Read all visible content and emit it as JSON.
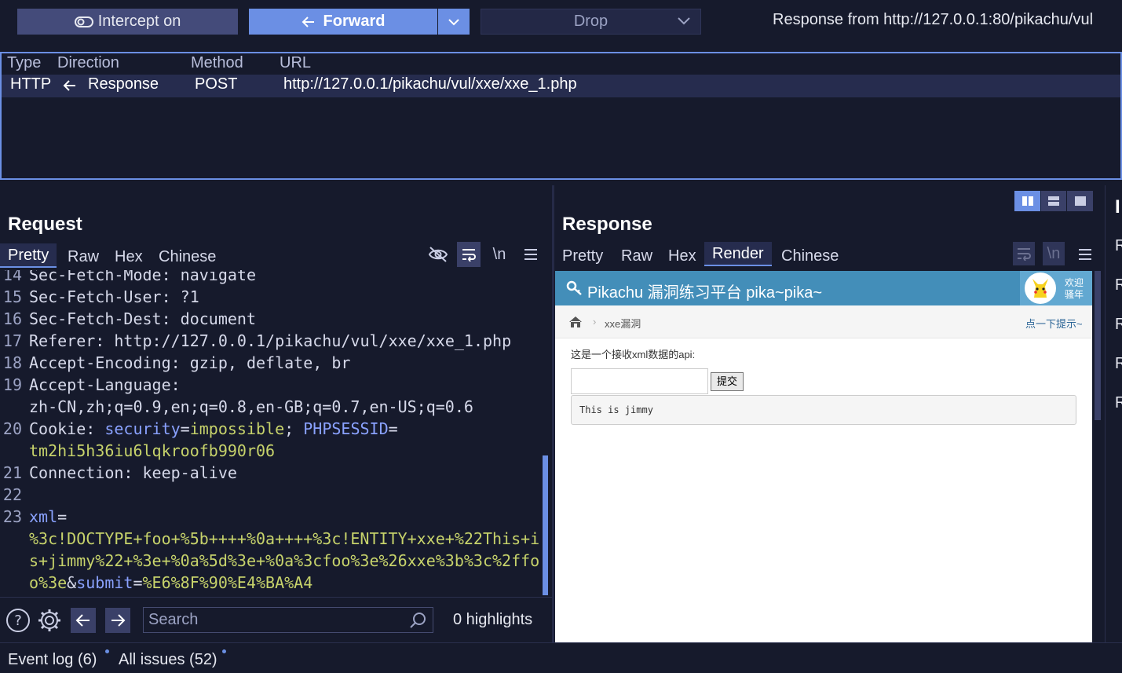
{
  "toolbar": {
    "intercept_label": "Intercept on",
    "forward_label": "Forward",
    "drop_label": "Drop",
    "response_from": "Response from http://127.0.0.1:80/pikachu/vul"
  },
  "history": {
    "columns": [
      "Type",
      "Direction",
      "Method",
      "URL"
    ],
    "row": {
      "type": "HTTP",
      "direction": "Response",
      "method": "POST",
      "url": "http://127.0.0.1/pikachu/vul/xxe/xxe_1.php"
    }
  },
  "request": {
    "title": "Request",
    "tabs": [
      "Pretty",
      "Raw",
      "Hex",
      "Chinese"
    ],
    "newline_toggle": "\\n",
    "lines": [
      {
        "n": "14",
        "key": "Sec-Fetch-Mode",
        "sep": ": ",
        "val": "navigate"
      },
      {
        "n": "15",
        "key": "Sec-Fetch-User",
        "sep": ": ",
        "val": "?1"
      },
      {
        "n": "16",
        "key": "Sec-Fetch-Dest",
        "sep": ": ",
        "val": "document"
      },
      {
        "n": "17",
        "key": "Referer",
        "sep": ": ",
        "val": "http://127.0.0.1/pikachu/vul/xxe/xxe_1.php"
      },
      {
        "n": "18",
        "key": "Accept-Encoding",
        "sep": ": ",
        "val": "gzip, deflate, br"
      },
      {
        "n": "19",
        "key": "Accept-Language",
        "sep": ":",
        "val": ""
      },
      {
        "n": "",
        "key": "",
        "sep": "",
        "val": "zh-CN,zh;q=0.9,en;q=0.8,en-GB;q=0.7,en-US;q=0.6"
      }
    ],
    "cookie": {
      "n": "20",
      "key": "Cookie",
      "c1k": "security",
      "c1v": "impossible",
      "c2k": "PHPSESSID",
      "c2v": "tm2hi5h36iu6lqkroofb990r06"
    },
    "line21": {
      "n": "21",
      "key": "Connection",
      "val": "keep-alive"
    },
    "line22": {
      "n": "22"
    },
    "body": {
      "n": "23",
      "k1": "xml",
      "v1a": "%3c!DOCTYPE+foo+%5b++++%0a++++%3c!ENTITY+xxe+%22This+i",
      "v1b": "s+jimmy%22+%3e+%0a%5d%3e+%0a%3cfoo%3e%26xxe%3b%3c%2ffo",
      "v1c": "o%3e",
      "k2": "submit",
      "v2": "%E6%8F%90%E4%BA%A4"
    },
    "search_placeholder": "Search",
    "highlights": "0 highlights"
  },
  "response": {
    "title": "Response",
    "tabs": [
      "Pretty",
      "Raw",
      "Hex",
      "Render",
      "Chinese"
    ],
    "newline_toggle": "\\n",
    "render": {
      "site_title": "Pikachu 漏洞练习平台 pika~pika~",
      "welcome_line1": "欢迎",
      "welcome_line2": "骚年",
      "breadcrumb": "xxe漏洞",
      "hint": "点一下提示~",
      "prompt": "这是一个接收xml数据的api:",
      "submit_label": "提交",
      "result": "This is jimmy"
    }
  },
  "inspector": {
    "letters": [
      "R",
      "R",
      "R",
      "R",
      "R"
    ]
  },
  "status": {
    "event_log": "Event log (6)",
    "all_issues": "All issues (52)"
  },
  "colors": {
    "accent": "#6b8fe4",
    "background": "#161a2c",
    "render_header": "#438eb9"
  }
}
